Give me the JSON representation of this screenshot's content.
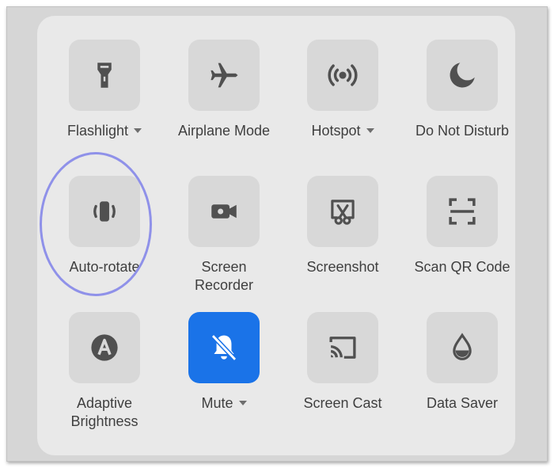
{
  "quick_settings": {
    "tiles": [
      {
        "label": "Flashlight",
        "icon": "flashlight-icon",
        "has_dropdown": true,
        "active": false
      },
      {
        "label": "Airplane Mode",
        "icon": "airplane-icon",
        "has_dropdown": false,
        "active": false
      },
      {
        "label": "Hotspot",
        "icon": "hotspot-icon",
        "has_dropdown": true,
        "active": false
      },
      {
        "label": "Do Not Disturb",
        "icon": "moon-icon",
        "has_dropdown": false,
        "active": false
      },
      {
        "label": "Auto-rotate",
        "icon": "auto-rotate-icon",
        "has_dropdown": false,
        "active": false
      },
      {
        "label": "Screen\nRecorder",
        "icon": "video-camera-icon",
        "has_dropdown": false,
        "active": false
      },
      {
        "label": "Screenshot",
        "icon": "screenshot-scissors-icon",
        "has_dropdown": false,
        "active": false
      },
      {
        "label": "Scan QR Code",
        "icon": "qr-scan-icon",
        "has_dropdown": false,
        "active": false
      },
      {
        "label": "Adaptive\nBrightness",
        "icon": "adaptive-brightness-icon",
        "has_dropdown": false,
        "active": false
      },
      {
        "label": "Mute",
        "icon": "bell-off-icon",
        "has_dropdown": true,
        "active": true
      },
      {
        "label": "Screen Cast",
        "icon": "cast-icon",
        "has_dropdown": false,
        "active": false
      },
      {
        "label": "Data Saver",
        "icon": "data-saver-icon",
        "has_dropdown": false,
        "active": false
      }
    ],
    "highlighted_tile": "Auto-rotate"
  },
  "colors": {
    "tile_bg": "#d8d8d8",
    "tile_active_bg": "#1a73e8",
    "icon": "#505050",
    "icon_active": "#ffffff",
    "label": "#3f3f3f",
    "highlight_ring": "#8f91e9"
  }
}
